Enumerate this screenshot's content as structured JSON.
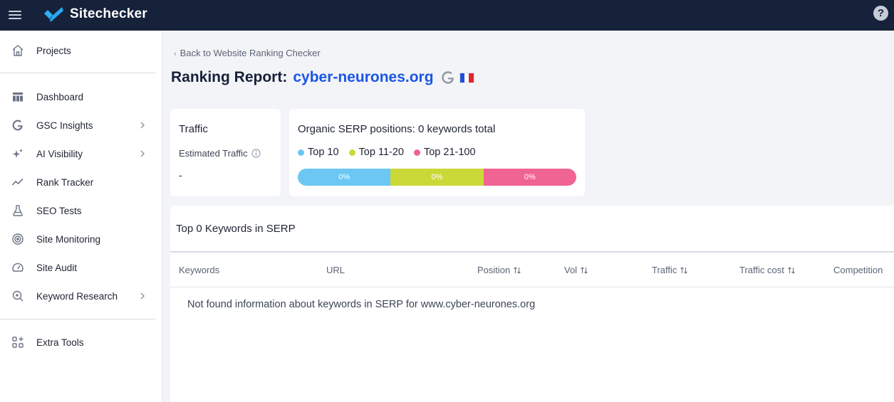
{
  "header": {
    "brand": "Sitechecker",
    "help_label": "?"
  },
  "sidebar": {
    "items": [
      {
        "label": "Projects",
        "icon": "home-icon"
      },
      {
        "label": "Dashboard",
        "icon": "dashboard-icon"
      },
      {
        "label": "GSC Insights",
        "icon": "google-icon"
      },
      {
        "label": "AI Visibility",
        "icon": "sparkle-icon"
      },
      {
        "label": "Rank Tracker",
        "icon": "trend-icon"
      },
      {
        "label": "SEO Tests",
        "icon": "flask-icon"
      },
      {
        "label": "Site Monitoring",
        "icon": "radar-icon"
      },
      {
        "label": "Site Audit",
        "icon": "gauge-icon"
      },
      {
        "label": "Keyword Research",
        "icon": "keyword-search-icon"
      },
      {
        "label": "Extra Tools",
        "icon": "apps-plus-icon"
      }
    ]
  },
  "main": {
    "back_link": "Back to Website Ranking Checker",
    "title_prefix": "Ranking Report:",
    "domain": "cyber-neurones.org",
    "search_engine": "G",
    "traffic_card": {
      "title": "Traffic",
      "estimated_label": "Estimated Traffic",
      "estimated_value": "-"
    },
    "serp_card": {
      "title": "Organic SERP positions: 0 keywords total",
      "legend": [
        {
          "label": "Top 10",
          "color": "#6cc7f2"
        },
        {
          "label": "Top 11-20",
          "color": "#cbd938"
        },
        {
          "label": "Top 21-100",
          "color": "#f06494"
        }
      ],
      "segments": [
        {
          "label": "0%",
          "value": 0,
          "color": "#6cc7f2"
        },
        {
          "label": "0%",
          "value": 0,
          "color": "#cbd938"
        },
        {
          "label": "0%",
          "value": 0,
          "color": "#f06494"
        }
      ]
    },
    "table": {
      "title": "Top 0 Keywords in SERP",
      "columns": [
        "Keywords",
        "URL",
        "Position",
        "Vol",
        "Traffic",
        "Traffic cost",
        "Competition"
      ],
      "empty_message": "Not found information about keywords in SERP for www.cyber-neurones.org"
    }
  },
  "colors": {
    "header_bg": "#16213a",
    "accent_blue": "#1a55e6",
    "flag_blue": "#1f4fd6",
    "flag_white": "#ffffff",
    "flag_red": "#e3262c"
  }
}
